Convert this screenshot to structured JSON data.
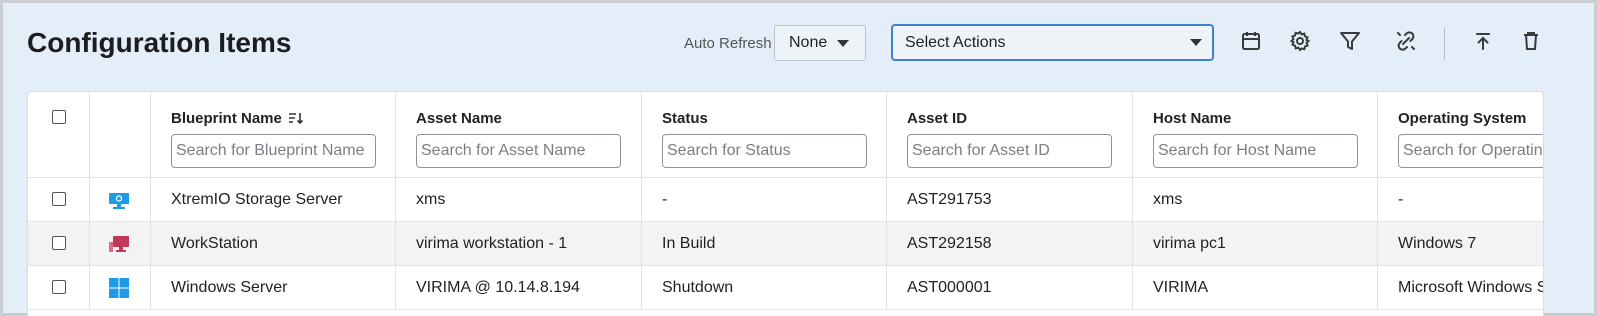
{
  "page": {
    "title": "Configuration Items"
  },
  "toolbar": {
    "auto_refresh_label": "Auto Refresh",
    "auto_refresh_value": "None",
    "actions_value": "Select Actions",
    "icons": [
      "calendar-icon",
      "gear-icon",
      "filter-icon",
      "unlink-icon",
      "export-icon",
      "trash-icon"
    ]
  },
  "grid": {
    "columns": [
      {
        "label": "Blueprint Name",
        "placeholder": "Search for Blueprint Name",
        "sorted": true
      },
      {
        "label": "Asset Name",
        "placeholder": "Search for Asset Name"
      },
      {
        "label": "Status",
        "placeholder": "Search for Status"
      },
      {
        "label": "Asset ID",
        "placeholder": "Search for Asset ID"
      },
      {
        "label": "Host Name",
        "placeholder": "Search for Host Name"
      },
      {
        "label": "Operating System",
        "placeholder": "Search for Operating System"
      }
    ],
    "rows": [
      {
        "icon": "storage-server-icon",
        "blueprint": "XtremIO Storage Server",
        "asset_name": "xms",
        "status": "-",
        "asset_id": "AST291753",
        "host": "xms",
        "os": "-"
      },
      {
        "icon": "workstation-icon",
        "blueprint": "WorkStation",
        "asset_name": "virima workstation - 1",
        "status": "In Build",
        "asset_id": "AST292158",
        "host": "virima pc1",
        "os": "Windows 7"
      },
      {
        "icon": "windows-icon",
        "blueprint": "Windows Server",
        "asset_name": "VIRIMA @ 10.14.8.194",
        "status": "Shutdown",
        "asset_id": "AST000001",
        "host": "VIRIMA",
        "os": "Microsoft Windows Server"
      }
    ]
  }
}
